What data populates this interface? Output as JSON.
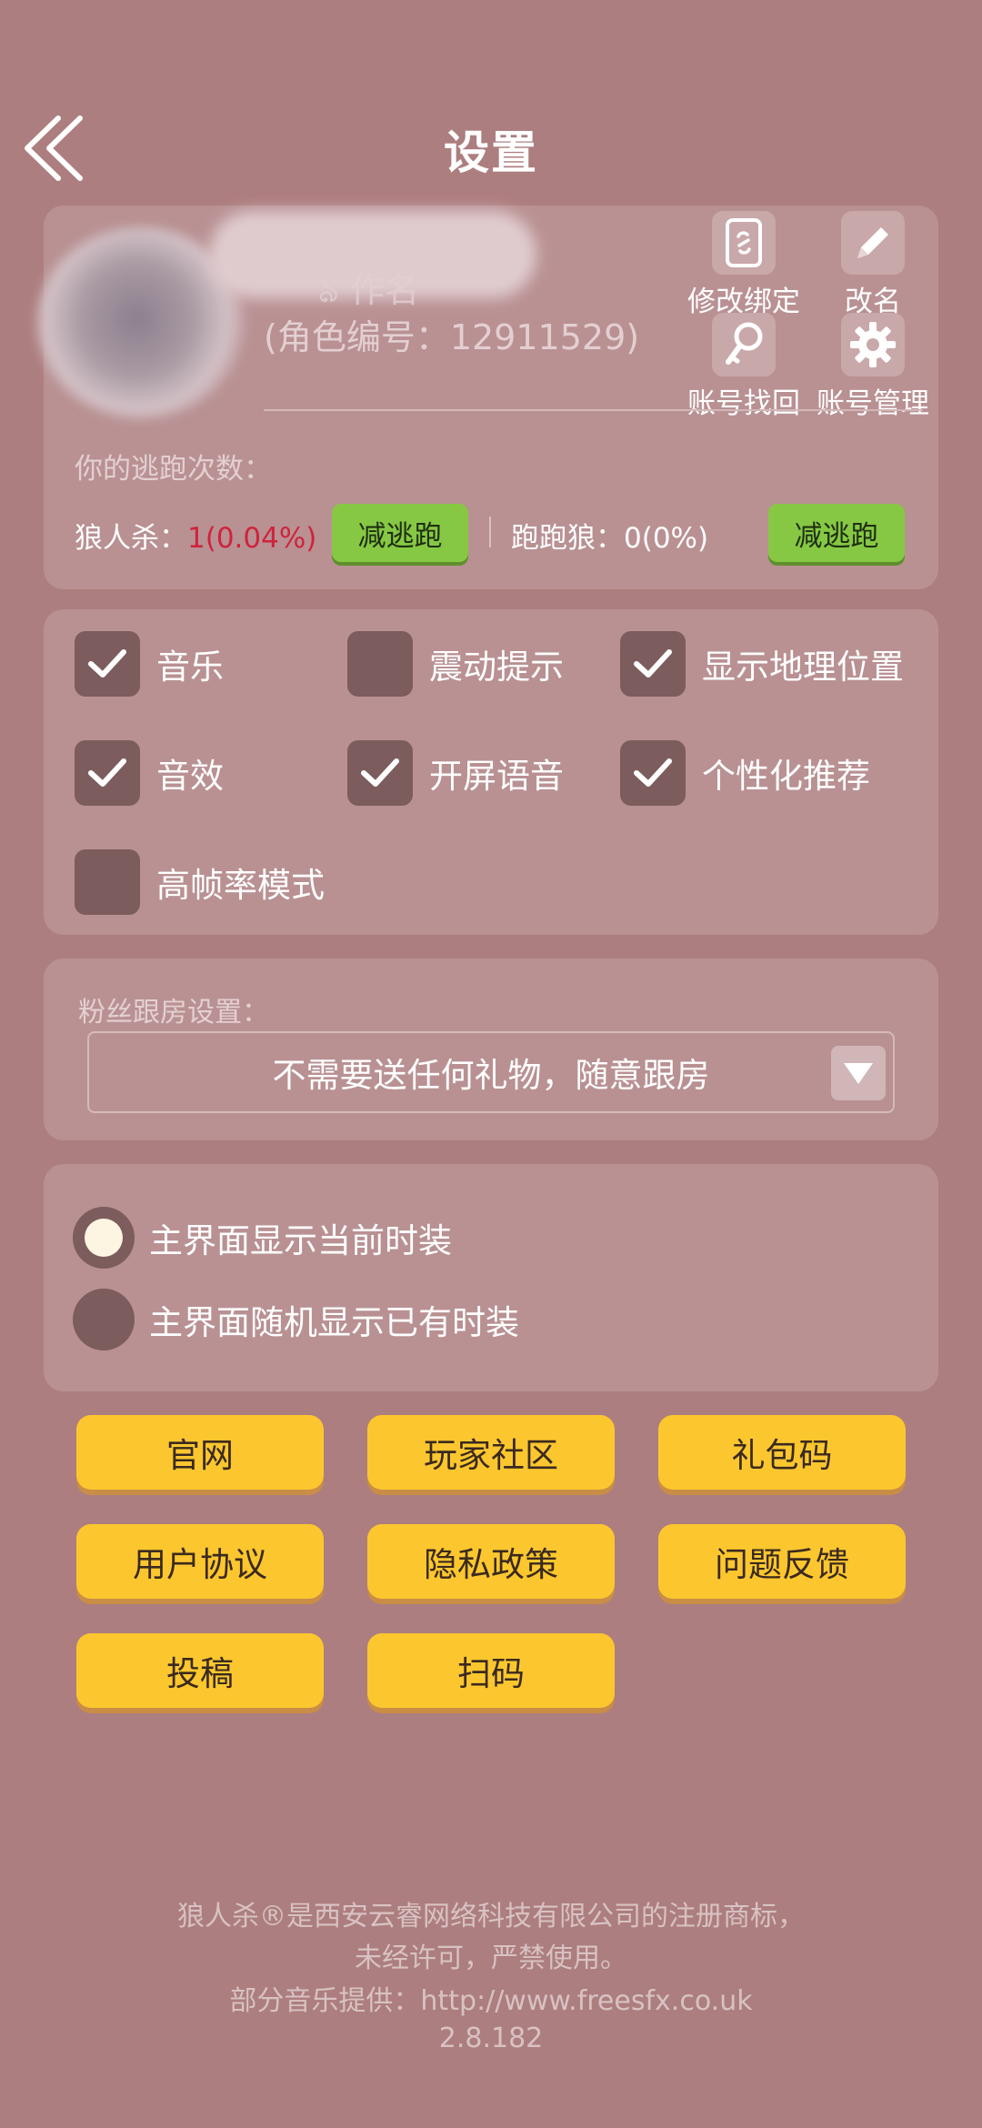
{
  "header": {
    "title": "设置"
  },
  "profile": {
    "name_fragment": "ঌ 作名",
    "role_id": "(角色编号：12911529)",
    "actions": [
      {
        "label": "修改绑定",
        "icon": "phone-bind-icon"
      },
      {
        "label": "改名",
        "icon": "pencil-icon"
      },
      {
        "label": "账号找回",
        "icon": "key-icon"
      },
      {
        "label": "账号管理",
        "icon": "gear-icon"
      }
    ],
    "escape": {
      "title": "你的逃跑次数：",
      "werewolf_label": "狼人杀：",
      "werewolf_value": "1(0.04%)",
      "runner_label": "跑跑狼：",
      "runner_value": "0(0%)",
      "reduce_label": "减逃跑"
    }
  },
  "options": [
    {
      "label": "音乐",
      "checked": true
    },
    {
      "label": "震动提示",
      "checked": false
    },
    {
      "label": "显示地理位置",
      "checked": true
    },
    {
      "label": "音效",
      "checked": true
    },
    {
      "label": "开屏语音",
      "checked": true
    },
    {
      "label": "个性化推荐",
      "checked": true
    },
    {
      "label": "高帧率模式",
      "checked": false
    }
  ],
  "fans": {
    "title": "粉丝跟房设置：",
    "selected": "不需要送任何礼物，随意跟房"
  },
  "skin": [
    {
      "label": "主界面显示当前时装",
      "selected": true
    },
    {
      "label": "主界面随机显示已有时装",
      "selected": false
    }
  ],
  "links": [
    "官网",
    "玩家社区",
    "礼包码",
    "用户协议",
    "隐私政策",
    "问题反馈",
    "投稿",
    "扫码"
  ],
  "footer": {
    "line1": "狼人杀®是西安云睿网络科技有限公司的注册商标，",
    "line2": "未经许可，严禁使用。",
    "line3": "部分音乐提供：http://www.freesfx.co.uk",
    "version": "2.8.182"
  },
  "colors": {
    "background": "#ad7e7f",
    "panel": "#b99193",
    "green_button": "#86c843",
    "yellow_button": "#fcc72e",
    "warning_red": "#d0233c"
  }
}
